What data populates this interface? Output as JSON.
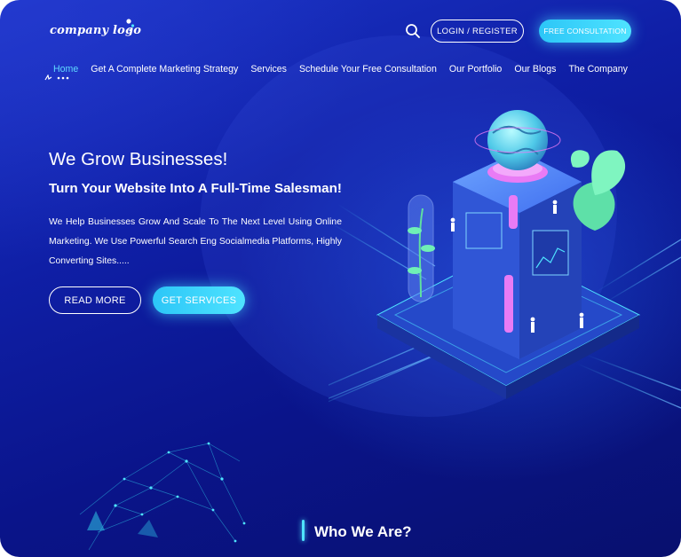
{
  "header": {
    "logo_text": "company logo",
    "search_icon": "search-icon",
    "login_label": "LOGIN / REGISTER",
    "consultation_label": "FREE CONSULTATION"
  },
  "nav": {
    "items": [
      {
        "label": "Home",
        "active": true
      },
      {
        "label": "Get A Complete Marketing Strategy",
        "active": false
      },
      {
        "label": "Services",
        "active": false
      },
      {
        "label": "Schedule Your Free Consultation",
        "active": false
      },
      {
        "label": "Our Portfolio",
        "active": false
      },
      {
        "label": "Our Blogs",
        "active": false
      },
      {
        "label": "The Company",
        "active": false
      }
    ]
  },
  "hero": {
    "title": "We Grow Businesses!",
    "subtitle": "Turn Your Website Into A Full-Time Salesman!",
    "description": "We Help Businesses Grow And Scale To The Next Level Using Online Marketing. We Use Powerful Search Eng Socialmedia Platforms, Highly Converting Sites.....",
    "read_more_label": "READ MORE",
    "get_services_label": "GET SERVICES"
  },
  "section": {
    "who_title": "Who We Are?"
  },
  "colors": {
    "background": "#0f1fa6",
    "accent": "#4fe3ff",
    "nav_active": "#5fd9ff",
    "text": "#ffffff"
  }
}
